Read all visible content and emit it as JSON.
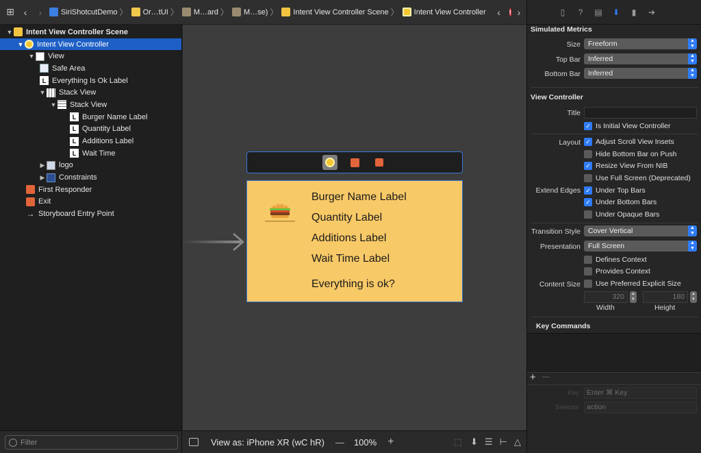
{
  "breadcrumb": {
    "project": "SiriShotcutDemo",
    "group": "Or…tUI",
    "storyboard1": "M…ard",
    "storyboard2": "M…se)",
    "scene": "Intent View Controller Scene",
    "controller": "Intent View Controller",
    "error_badge": "!"
  },
  "outline": {
    "rows": [
      {
        "label": "Intent View Controller Scene"
      },
      {
        "label": "Intent View Controller"
      },
      {
        "label": "View"
      },
      {
        "label": "Safe Area"
      },
      {
        "label": "Everything Is Ok Label"
      },
      {
        "label": "Stack View"
      },
      {
        "label": "Stack View"
      },
      {
        "label": "Burger Name Label"
      },
      {
        "label": "Quantity Label"
      },
      {
        "label": "Additions Label"
      },
      {
        "label": "Wait Time"
      },
      {
        "label": "logo"
      },
      {
        "label": "Constraints"
      },
      {
        "label": "First Responder"
      },
      {
        "label": "Exit"
      },
      {
        "label": "Storyboard Entry Point"
      }
    ],
    "label_glyph": "L",
    "filter_placeholder": "Filter"
  },
  "scene": {
    "labels": [
      "Burger Name Label",
      "Quantity Label",
      "Additions Label",
      "Wait Time Label",
      "Everything is ok?"
    ]
  },
  "canvas_bar": {
    "view_as": "View as: iPhone XR (wC hR)",
    "zoom_minus": "—",
    "zoom": "100%",
    "zoom_plus": "+"
  },
  "inspector": {
    "simulated_metrics": {
      "title": "Simulated Metrics",
      "size_label": "Size",
      "size_value": "Freeform",
      "top_bar_label": "Top Bar",
      "top_bar_value": "Inferred",
      "bottom_bar_label": "Bottom Bar",
      "bottom_bar_value": "Inferred"
    },
    "view_controller": {
      "title": "View Controller",
      "title_label": "Title",
      "title_value": "",
      "initial_vc": {
        "label": "Is Initial View Controller",
        "checked": true
      },
      "layout_label": "Layout",
      "layout_options": [
        {
          "label": "Adjust Scroll View Insets",
          "checked": true
        },
        {
          "label": "Hide Bottom Bar on Push",
          "checked": false
        },
        {
          "label": "Resize View From NIB",
          "checked": true
        },
        {
          "label": "Use Full Screen (Deprecated)",
          "checked": false
        }
      ],
      "extend_edges_label": "Extend Edges",
      "extend_edges_options": [
        {
          "label": "Under Top Bars",
          "checked": true
        },
        {
          "label": "Under Bottom Bars",
          "checked": true
        },
        {
          "label": "Under Opaque Bars",
          "checked": false
        }
      ],
      "transition_style_label": "Transition Style",
      "transition_style_value": "Cover Vertical",
      "presentation_label": "Presentation",
      "presentation_value": "Full Screen",
      "defines_context": {
        "label": "Defines Context",
        "checked": false
      },
      "provides_context": {
        "label": "Provides Context",
        "checked": false
      },
      "content_size_label": "Content Size",
      "preferred_size": {
        "label": "Use Preferred Explicit Size",
        "checked": false
      },
      "width_value": "320",
      "height_value": "180",
      "width_caption": "Width",
      "height_caption": "Height"
    },
    "key_commands": {
      "title": "Key Commands",
      "add": "+",
      "remove": "—",
      "key_label": "Key",
      "key_placeholder": "Enter ⌘ Key",
      "selector_label": "Selector",
      "selector_placeholder": "action"
    }
  }
}
